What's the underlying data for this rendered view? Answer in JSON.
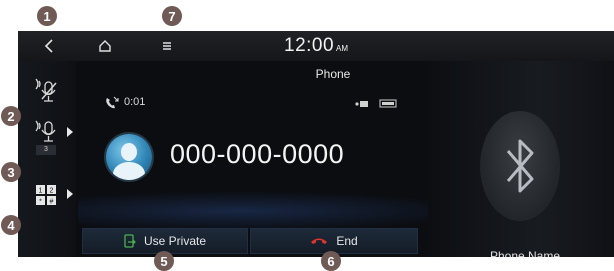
{
  "callouts": [
    "1",
    "2",
    "3",
    "4",
    "5",
    "6",
    "7"
  ],
  "topbar": {
    "time": "12:00",
    "ampm": "AM",
    "title": "Phone"
  },
  "call": {
    "duration": "0:01",
    "number": "000-000-0000"
  },
  "side_buttons": {
    "mic_sub_label": "3"
  },
  "bottom_buttons": {
    "private_label": "Use Private",
    "end_label": "End"
  },
  "right_panel": {
    "device_name": "Phone Name"
  },
  "icons": [
    "back-icon",
    "home-icon",
    "menu-icon",
    "mic-mute-icon",
    "mic-volume-icon",
    "keypad-icon",
    "call-incoming-icon",
    "signal-icon",
    "battery-icon",
    "contact-avatar-icon",
    "phone-to-car-icon",
    "end-call-icon",
    "bluetooth-icon"
  ],
  "colors": {
    "background": "#0b0d11",
    "callout": "#6f5a56",
    "end_call": "#e0342c",
    "private_icon": "#4caf50"
  }
}
